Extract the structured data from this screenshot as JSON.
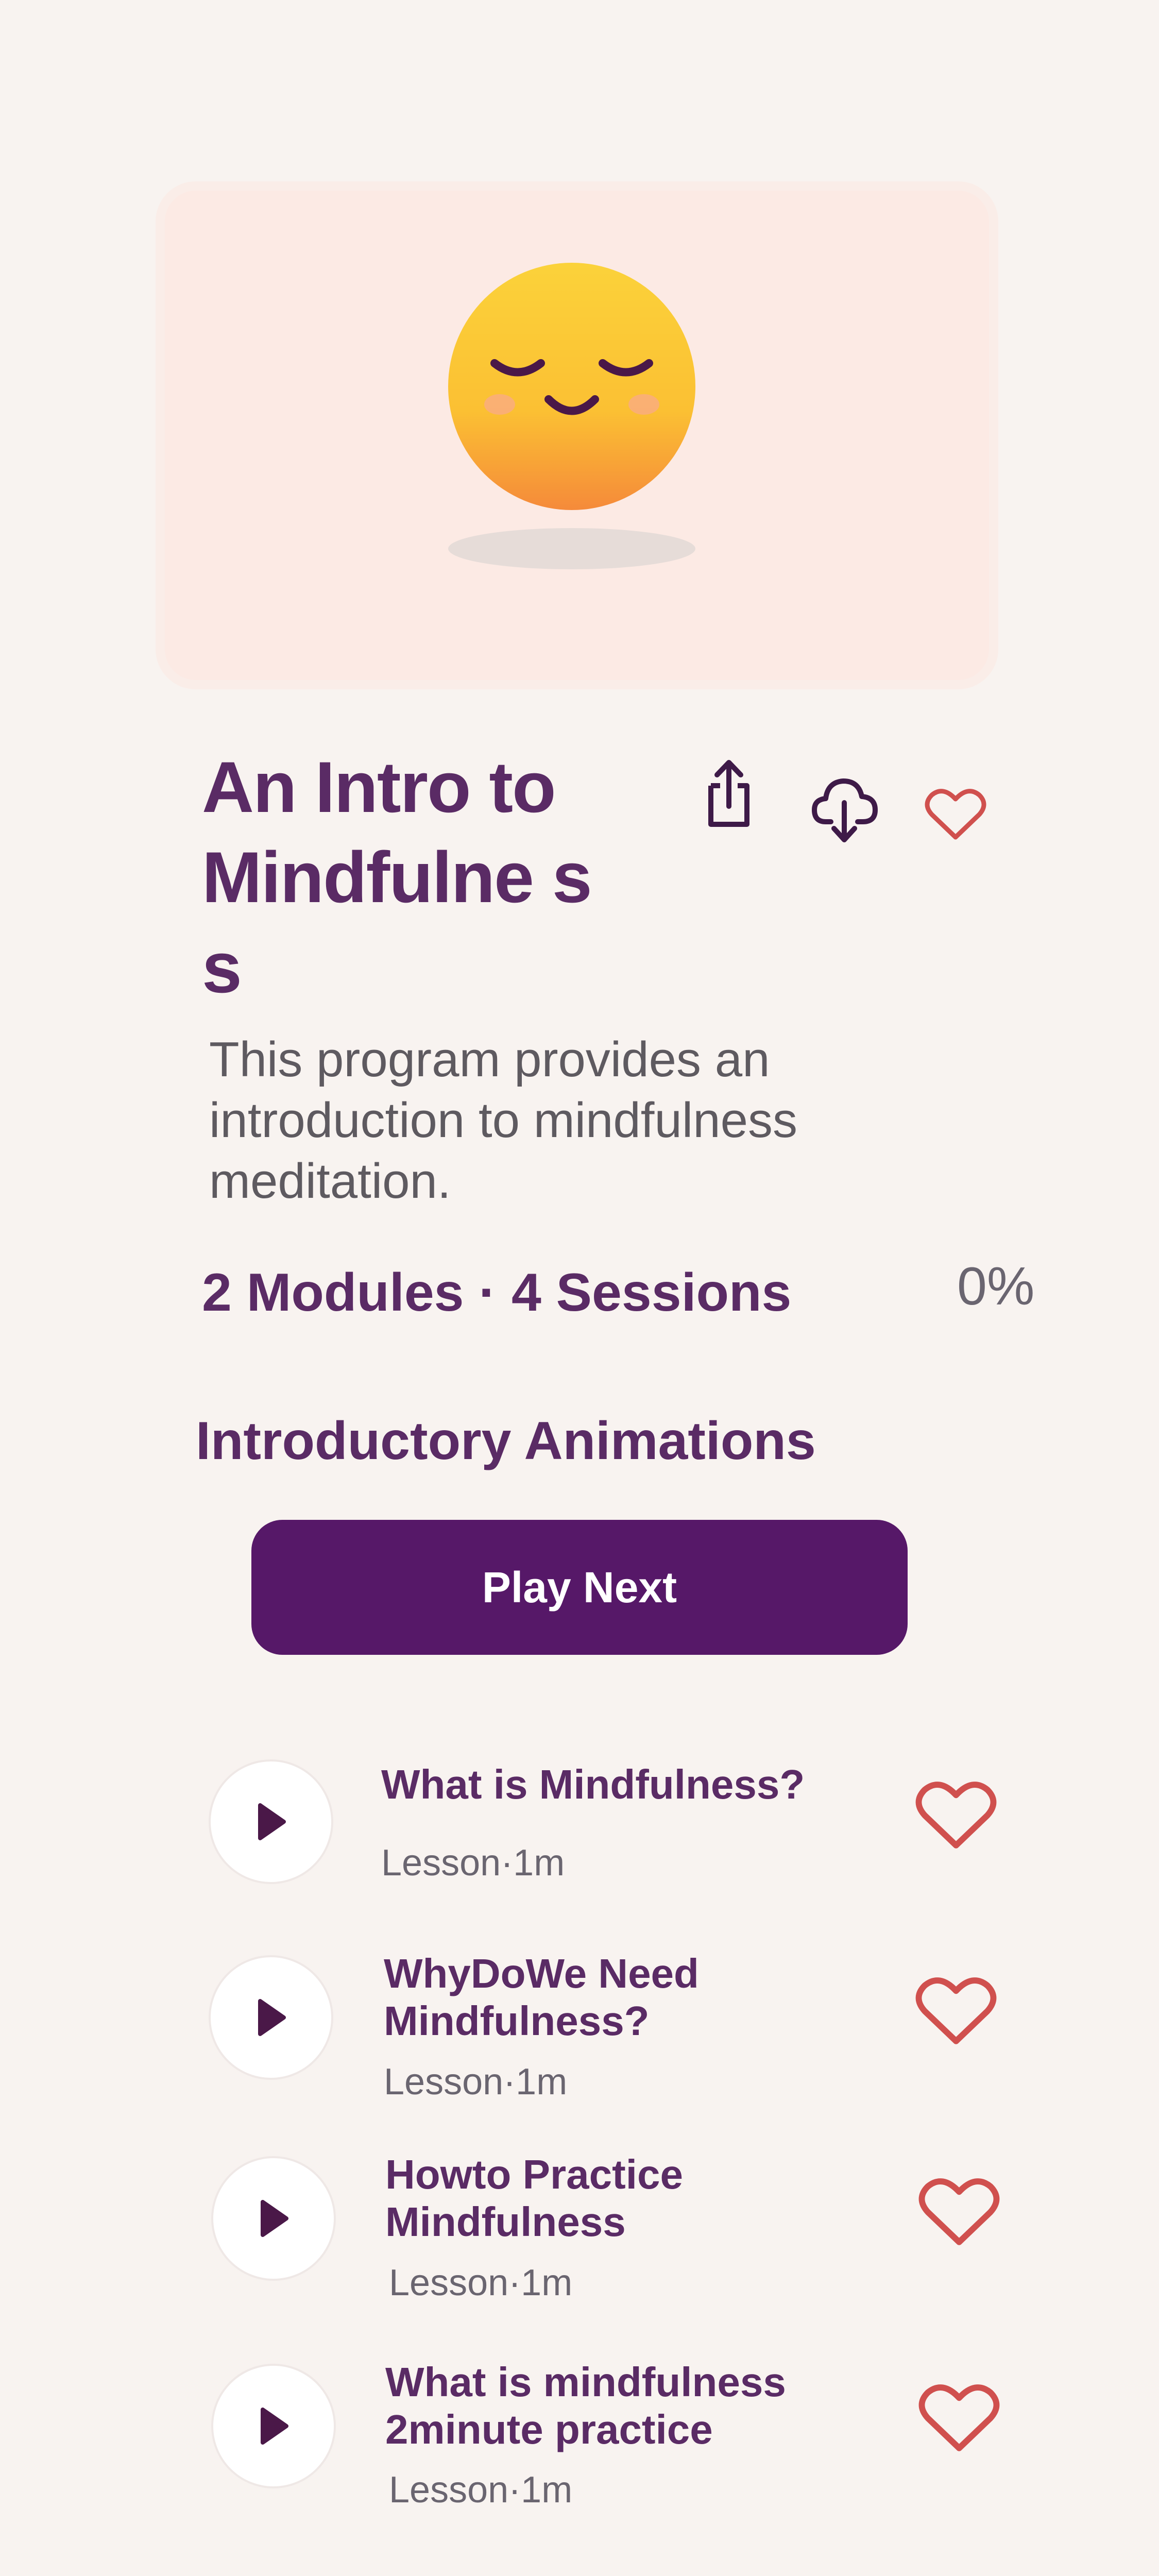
{
  "program": {
    "title": "An Intro to Mindfulne ss",
    "description": "This program provides an introduction to mindfulness meditation.",
    "meta": "2 Modules · 4 Sessions",
    "progress": "0%"
  },
  "actions": {
    "share_icon": "share-icon",
    "download_icon": "cloud-download-icon",
    "favorite_icon": "heart-outline-icon"
  },
  "section": {
    "title": "Introductory Animations",
    "play_next_label": "Play Next"
  },
  "lessons": [
    {
      "title": "What is Mindfulness?",
      "subtitle": "Lesson·1m"
    },
    {
      "title": "WhyDoWe Need Mindfulness?",
      "subtitle": "Lesson·1m"
    },
    {
      "title": "Howto Practice Mindfulness",
      "subtitle": "Lesson·1m"
    },
    {
      "title": "What is mindfulness 2minute practice",
      "subtitle": "Lesson·1m"
    }
  ],
  "colors": {
    "brand_purple": "#561868",
    "text_purple": "#5A2B65",
    "heart_red": "#D0504E",
    "background": "#F8F3F0",
    "hero_bg": "#FCEAE4"
  }
}
